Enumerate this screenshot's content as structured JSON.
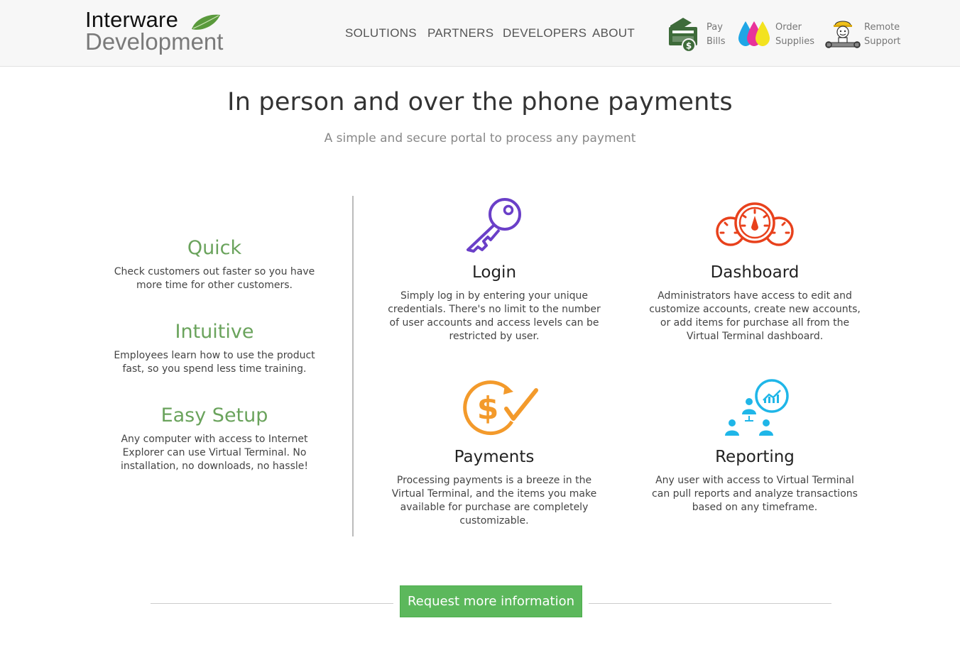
{
  "brand": {
    "line1": "Interware",
    "line2": "Development"
  },
  "nav": [
    {
      "label": "SOLUTIONS"
    },
    {
      "label": "PARTNERS"
    },
    {
      "label": "DEVELOPERS"
    },
    {
      "label": "ABOUT"
    }
  ],
  "quick_links": [
    {
      "line1": "Pay",
      "line2": "Bills",
      "icon": "bill-payment-icon"
    },
    {
      "line1": "Order",
      "line2": "Supplies",
      "icon": "ink-drops-icon"
    },
    {
      "line1": "Remote",
      "line2": "Support",
      "icon": "support-mascot-icon"
    }
  ],
  "hero": {
    "title": "In person and over the phone payments",
    "subtitle": "A simple and secure portal to process any payment"
  },
  "benefits": [
    {
      "title": "Quick",
      "text": "Check customers out faster so you have more time for other customers."
    },
    {
      "title": "Intuitive",
      "text": "Employees learn how to use the product fast, so you spend less time training."
    },
    {
      "title": "Easy Setup",
      "text": "Any computer with access to Internet Explorer can use Virtual Terminal. No installation, no downloads, no hassle!"
    }
  ],
  "features": [
    {
      "title": "Login",
      "icon": "key-icon",
      "text": "Simply log in by entering your unique credentials. There's no limit to the number of user accounts and access levels can be restricted by user."
    },
    {
      "title": "Dashboard",
      "icon": "gauges-icon",
      "text": "Administrators have access to edit and customize accounts, create new accounts, or add items for purchase all from the Virtual Terminal dashboard."
    },
    {
      "title": "Payments",
      "icon": "dollar-check-icon",
      "text": "Processing payments is a breeze in the Virtual Terminal, and the items you make available for purchase are completely customizable."
    },
    {
      "title": "Reporting",
      "icon": "team-report-icon",
      "text": "Any user with access to Virtual Terminal can pull reports and analyze transactions based on any timeframe."
    }
  ],
  "cta": {
    "label": "Request more information"
  },
  "colors": {
    "accent_green": "#5cb85c",
    "benefit_green": "#6aa35c",
    "key_purple": "#6a3fc8",
    "gauge_red": "#e8411c",
    "payment_orange": "#f39a2b",
    "report_cyan": "#1fb6e8"
  }
}
